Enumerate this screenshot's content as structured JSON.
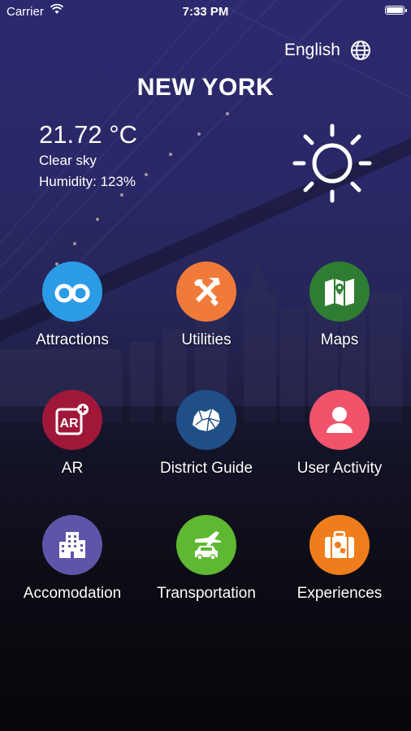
{
  "status_bar": {
    "carrier": "Carrier",
    "time": "7:33 PM"
  },
  "language": {
    "label": "English",
    "icon": "globe-icon"
  },
  "city": "NEW YORK",
  "weather": {
    "temperature": "21.72 °C",
    "description": "Clear sky",
    "humidity": "Humidity: 123%",
    "icon": "sun-icon"
  },
  "menu": [
    {
      "label": "Attractions",
      "icon": "binoculars-icon",
      "color": "#2c9be6"
    },
    {
      "label": "Utilities",
      "icon": "tools-icon",
      "color": "#f07a3a"
    },
    {
      "label": "Maps",
      "icon": "map-icon",
      "color": "#2e7d32"
    },
    {
      "label": "AR",
      "icon": "ar-icon",
      "color": "#a0173a"
    },
    {
      "label": "District Guide",
      "icon": "district-map-icon",
      "color": "#1f4f86"
    },
    {
      "label": "User Activity",
      "icon": "user-icon",
      "color": "#f0536a"
    },
    {
      "label": "Accomodation",
      "icon": "building-icon",
      "color": "#5f55a8"
    },
    {
      "label": "Transportation",
      "icon": "transport-icon",
      "color": "#5fb832"
    },
    {
      "label": "Experiences",
      "icon": "suitcase-icon",
      "color": "#f07d1c"
    }
  ]
}
